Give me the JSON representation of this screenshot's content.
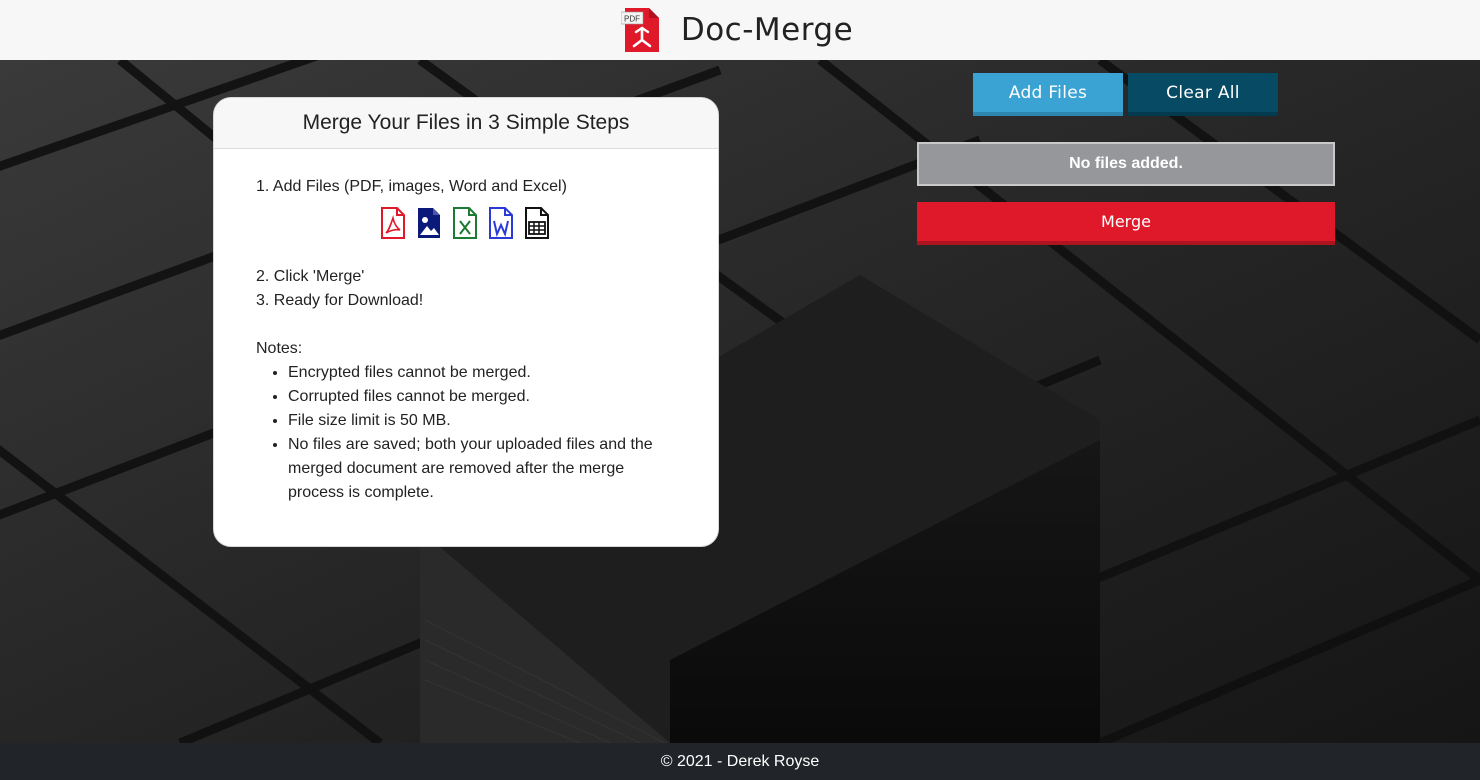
{
  "header": {
    "title": "Doc-Merge",
    "logo_badge": "PDF"
  },
  "card": {
    "title": "Merge Your Files in 3 Simple Steps",
    "step1": "1. Add Files (PDF, images, Word and Excel)",
    "file_types": [
      {
        "icon": "pdf-file-icon",
        "color": "#e0192a"
      },
      {
        "icon": "image-file-icon",
        "color": "#0b1a7a"
      },
      {
        "icon": "excel-file-icon",
        "color": "#1d7a32"
      },
      {
        "icon": "word-file-icon",
        "color": "#2a3ad8"
      },
      {
        "icon": "spreadsheet-file-icon",
        "color": "#111111"
      }
    ],
    "step2": "2. Click 'Merge'",
    "step3": "3. Ready for Download!",
    "notes_title": "Notes:",
    "notes": [
      "Encrypted files cannot be merged.",
      "Corrupted files cannot be merged.",
      "File size limit is 50 MB.",
      "No files are saved; both your uploaded files and the merged document are removed after the merge process is complete."
    ]
  },
  "actions": {
    "add_files": "Add Files",
    "clear_all": "Clear All",
    "status": "No files added.",
    "merge": "Merge"
  },
  "footer": {
    "text": "© 2021 - Derek Royse"
  },
  "colors": {
    "add_files": "#3aa3d3",
    "clear_all": "#064a64",
    "merge": "#e0192a",
    "status_box": "#96979a",
    "footer": "#212428"
  }
}
